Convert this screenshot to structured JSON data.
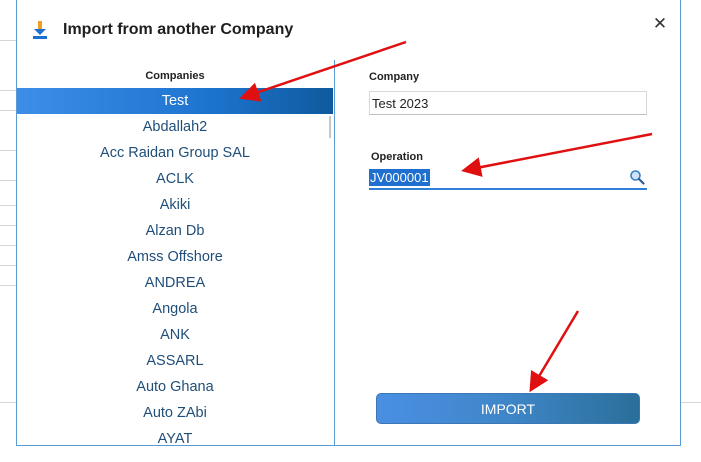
{
  "dialog": {
    "title": "Import from another Company",
    "close_glyph": "✕"
  },
  "companies": {
    "header": "Companies",
    "items": [
      "Test",
      "Abdallah2",
      "Acc Raidan Group SAL",
      "ACLK",
      "Akiki",
      "Alzan Db",
      "Amss Offshore",
      "ANDREA",
      "Angola",
      "ANK",
      "ASSARL",
      "Auto Ghana",
      "Auto ZAbi",
      "AYAT"
    ],
    "selected": "Test"
  },
  "company_field": {
    "label": "Company",
    "value": "Test 2023"
  },
  "operation_field": {
    "label": "Operation",
    "value": "JV000001"
  },
  "import_button": {
    "label": "IMPORT"
  },
  "colors": {
    "accent": "#1f6fd0",
    "annotation_arrow": "#e01010"
  },
  "icons": {
    "title": "download-icon",
    "search": "magnifier-icon",
    "close": "close-icon"
  }
}
